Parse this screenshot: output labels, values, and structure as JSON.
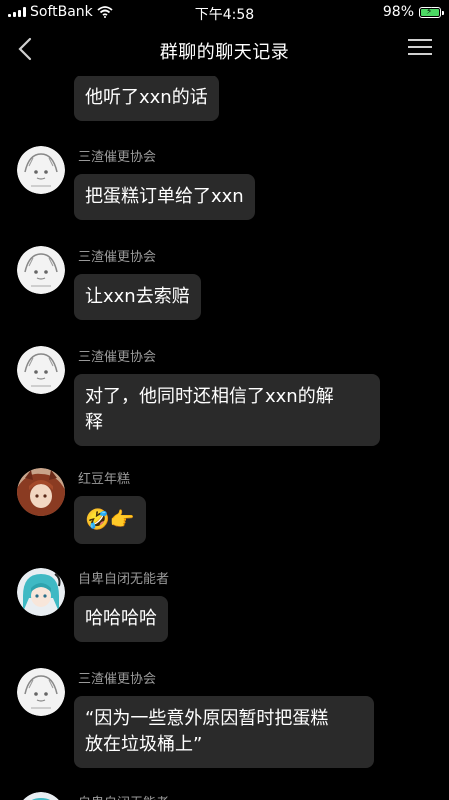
{
  "status_bar": {
    "carrier": "SoftBank",
    "time": "下午4:58",
    "battery": "98%",
    "battery_color": "#4cd964"
  },
  "nav": {
    "title": "群聊的聊天记录",
    "back_icon": "chevron-left-icon",
    "menu_icon": "hamburger-menu-icon"
  },
  "messages": [
    {
      "sender": "",
      "text": "他听了xxn的话"
    },
    {
      "sender": "三渣催更协会",
      "text": "把蛋糕订单给了xxn"
    },
    {
      "sender": "三渣催更协会",
      "text": "让xxn去索赔"
    },
    {
      "sender": "三渣催更协会",
      "text_line1": "对了，他同时还相信了xxn的解",
      "text_line2": "释"
    },
    {
      "sender": "红豆年糕",
      "text": "🤣👉"
    },
    {
      "sender": "自卑自闭无能者",
      "text": "哈哈哈哈"
    },
    {
      "sender": "三渣催更协会",
      "text_line1": "“因为一些意外原因暂时把蛋糕",
      "text_line2": "放在垃圾桶上”"
    },
    {
      "sender": "自卑自闭无能者",
      "text": ""
    }
  ],
  "colors": {
    "background": "#000000",
    "bubble": "#2a2a2a",
    "sender_text": "#9a9a9a"
  }
}
